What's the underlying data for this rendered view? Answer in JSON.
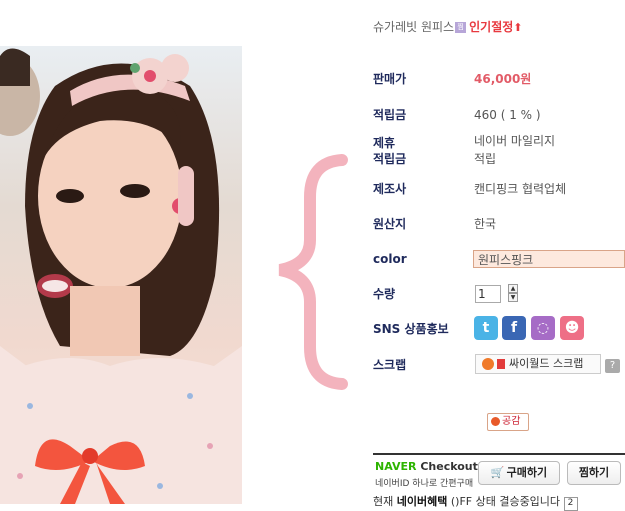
{
  "product": {
    "title": "슈가레빗 원피스",
    "tag_icon": "찜",
    "hot_label": "인기절정",
    "hot_arrow": "⬆"
  },
  "details": [
    {
      "label": "판매가",
      "value": "46,000원"
    },
    {
      "label": "적립금",
      "value": "460 ( 1 % )"
    },
    {
      "label_line1": "제휴",
      "label_line2": "적립금",
      "value_line1": "네이버 마일리지",
      "value_line2": "적립"
    },
    {
      "label": "제조사",
      "value": "캔디핑크 협력업체"
    },
    {
      "label": "원산지",
      "value": "한국"
    },
    {
      "label": "color",
      "value": "원피스핑크"
    },
    {
      "label": "수량",
      "value": "1"
    },
    {
      "label": "SNS 상품홍보"
    },
    {
      "label": "스크랩"
    }
  ],
  "sns": {
    "twitter": "t",
    "facebook": "f",
    "talk": "◌",
    "me2day": "☻",
    "icons": [
      "twitter-icon",
      "facebook-icon",
      "talk-icon",
      "me2day-icon"
    ],
    "colors": [
      "#4ab3e6",
      "#3a67b4",
      "#a66cc6",
      "#ee6f86"
    ]
  },
  "scrap": {
    "label": "싸이월드 스크랩",
    "help": "?"
  },
  "like": {
    "label": "공감"
  },
  "naver": {
    "brand": "NAVER",
    "checkout": "Checkout",
    "sub": "네이버ID 하나로 간편구매",
    "buy_label": "구매하기",
    "wish_label": "찜하기"
  },
  "bottom_text": {
    "pre": "현재 ",
    "bold": "네이버혜택",
    "post": " ()FF 상태 결승중입니다 ",
    "q": "2"
  },
  "accent": {
    "brace": "#f3b3bd",
    "price": "#e25b67",
    "label": "#1f2a5c"
  }
}
